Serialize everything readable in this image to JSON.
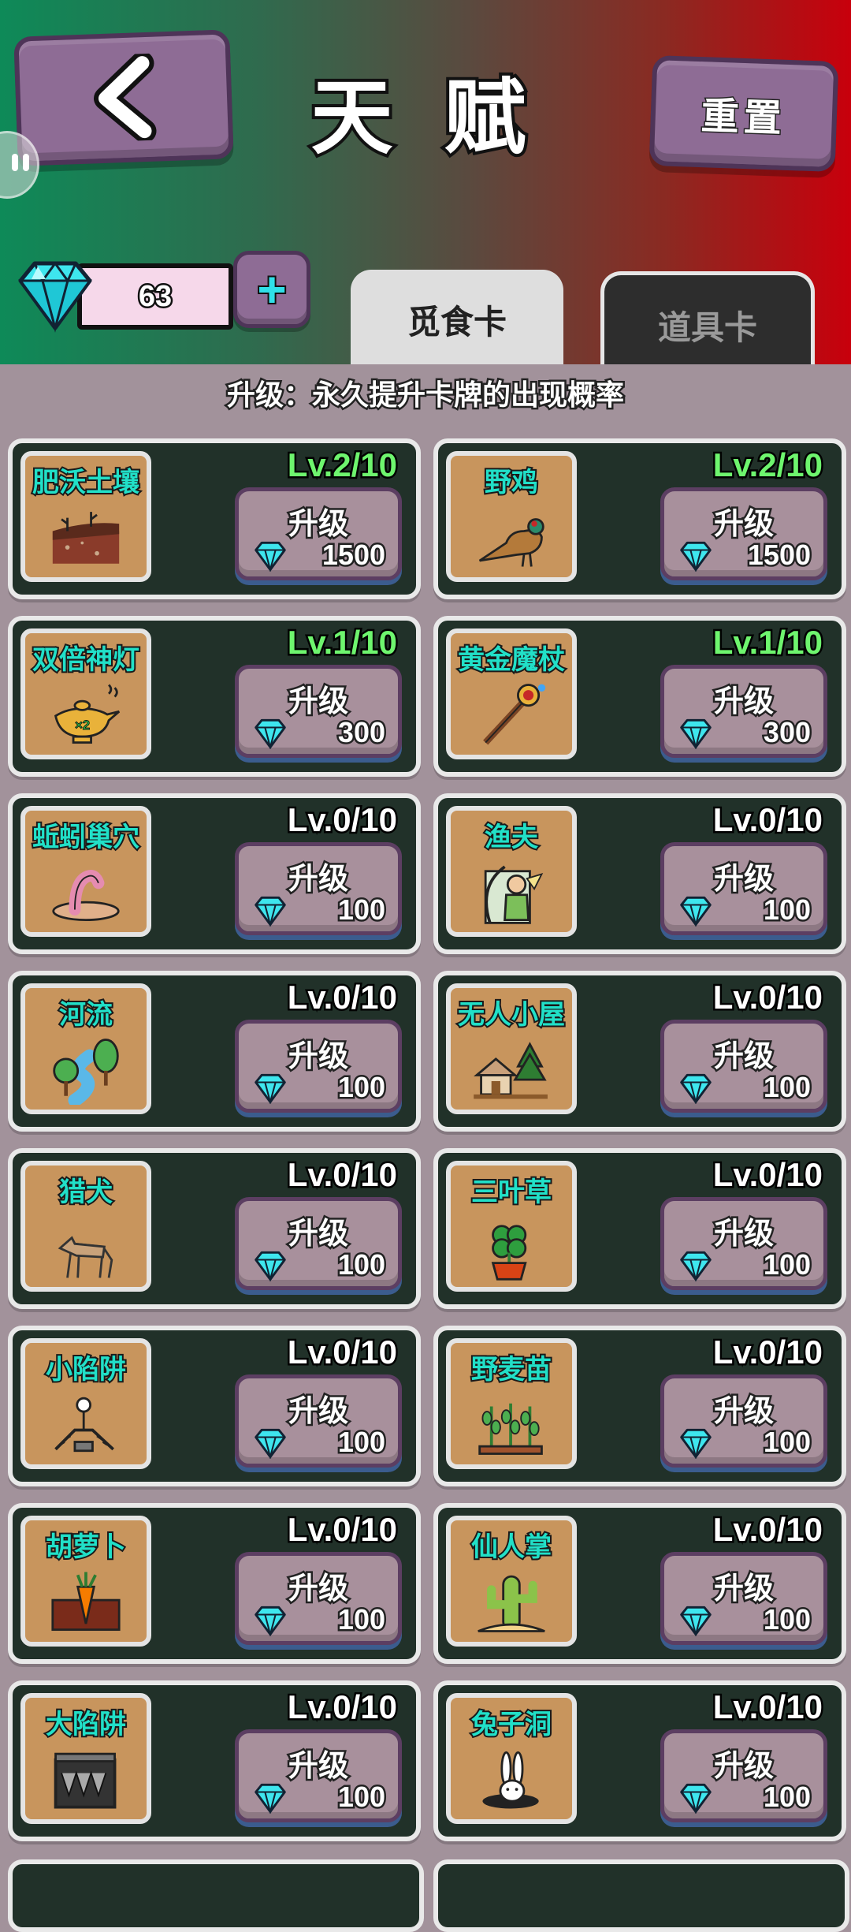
{
  "header": {
    "title": "天 赋",
    "reset_label": "重置",
    "gem_count": "63"
  },
  "tabs": [
    {
      "label": "觅食卡",
      "active": true
    },
    {
      "label": "道具卡",
      "active": false
    }
  ],
  "subtitle": "升级：永久提升卡牌的出现概率",
  "colors": {
    "level_upgraded": "#6ef56e",
    "card_name": "#21e0c8",
    "card_bg": "#213129",
    "gem": "#3ee6ee"
  },
  "upgrade_label": "升级",
  "cards": [
    {
      "name": "肥沃土壤",
      "icon": "soil-icon",
      "level": "Lv.2/10",
      "cost": "1500",
      "upgraded": true
    },
    {
      "name": "野鸡",
      "icon": "pheasant-icon",
      "level": "Lv.2/10",
      "cost": "1500",
      "upgraded": true
    },
    {
      "name": "双倍神灯",
      "icon": "magic-lamp-icon",
      "level": "Lv.1/10",
      "cost": "300",
      "upgraded": true
    },
    {
      "name": "黄金魔杖",
      "icon": "magic-wand-icon",
      "level": "Lv.1/10",
      "cost": "300",
      "upgraded": true
    },
    {
      "name": "蚯蚓巢穴",
      "icon": "worm-nest-icon",
      "level": "Lv.0/10",
      "cost": "100",
      "upgraded": false
    },
    {
      "name": "渔夫",
      "icon": "fisherman-icon",
      "level": "Lv.0/10",
      "cost": "100",
      "upgraded": false
    },
    {
      "name": "河流",
      "icon": "river-icon",
      "level": "Lv.0/10",
      "cost": "100",
      "upgraded": false
    },
    {
      "name": "无人小屋",
      "icon": "cabin-icon",
      "level": "Lv.0/10",
      "cost": "100",
      "upgraded": false
    },
    {
      "name": "猎犬",
      "icon": "hound-icon",
      "level": "Lv.0/10",
      "cost": "100",
      "upgraded": false
    },
    {
      "name": "三叶草",
      "icon": "clover-icon",
      "level": "Lv.0/10",
      "cost": "100",
      "upgraded": false
    },
    {
      "name": "小陷阱",
      "icon": "small-trap-icon",
      "level": "Lv.0/10",
      "cost": "100",
      "upgraded": false
    },
    {
      "name": "野麦苗",
      "icon": "wheat-sprout-icon",
      "level": "Lv.0/10",
      "cost": "100",
      "upgraded": false
    },
    {
      "name": "胡萝卜",
      "icon": "carrot-icon",
      "level": "Lv.0/10",
      "cost": "100",
      "upgraded": false
    },
    {
      "name": "仙人掌",
      "icon": "cactus-icon",
      "level": "Lv.0/10",
      "cost": "100",
      "upgraded": false
    },
    {
      "name": "大陷阱",
      "icon": "big-trap-icon",
      "level": "Lv.0/10",
      "cost": "100",
      "upgraded": false
    },
    {
      "name": "兔子洞",
      "icon": "rabbit-hole-icon",
      "level": "Lv.0/10",
      "cost": "100",
      "upgraded": false
    }
  ]
}
